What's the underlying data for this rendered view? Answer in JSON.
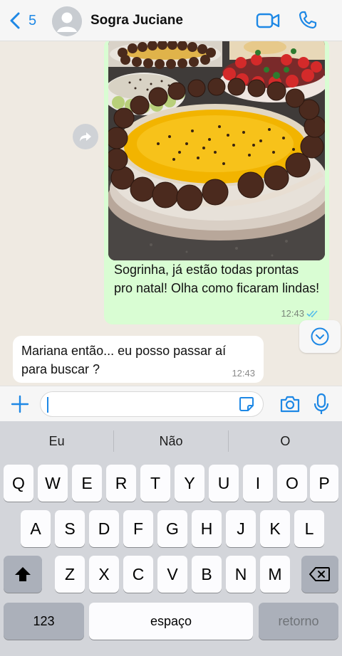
{
  "header": {
    "back_count": "5",
    "contact_name": "Sogra Juciane"
  },
  "messages": {
    "outgoing": {
      "text": "Sogrinha, já estão todas prontas pro natal! Olha como ficaram lindas!",
      "time": "12:43",
      "status": "read"
    },
    "incoming": {
      "text": "Mariana então... eu posso passar aí para buscar ?",
      "time": "12:43"
    }
  },
  "composer": {
    "value": "",
    "placeholder": ""
  },
  "keyboard": {
    "suggestions": [
      "Eu",
      "Não",
      "O"
    ],
    "row1": [
      "Q",
      "W",
      "E",
      "R",
      "T",
      "Y",
      "U",
      "I",
      "O",
      "P"
    ],
    "row2": [
      "A",
      "S",
      "D",
      "F",
      "G",
      "H",
      "J",
      "K",
      "L"
    ],
    "row3": [
      "Z",
      "X",
      "C",
      "V",
      "B",
      "N",
      "M"
    ],
    "numbers_label": "123",
    "space_label": "espaço",
    "return_label": "retorno"
  },
  "colors": {
    "accent": "#1e88e5",
    "outgoing_bubble": "#d9fdd3",
    "incoming_bubble": "#ffffff",
    "chat_background": "#efeae2",
    "read_ticks": "#53bdeb"
  },
  "icons": [
    "chevron-left-icon",
    "avatar-icon",
    "video-camera-icon",
    "phone-icon",
    "forward-icon",
    "double-check-icon",
    "chevron-down-icon",
    "plus-icon",
    "sticker-icon",
    "camera-icon",
    "microphone-icon",
    "shift-icon",
    "backspace-icon"
  ]
}
